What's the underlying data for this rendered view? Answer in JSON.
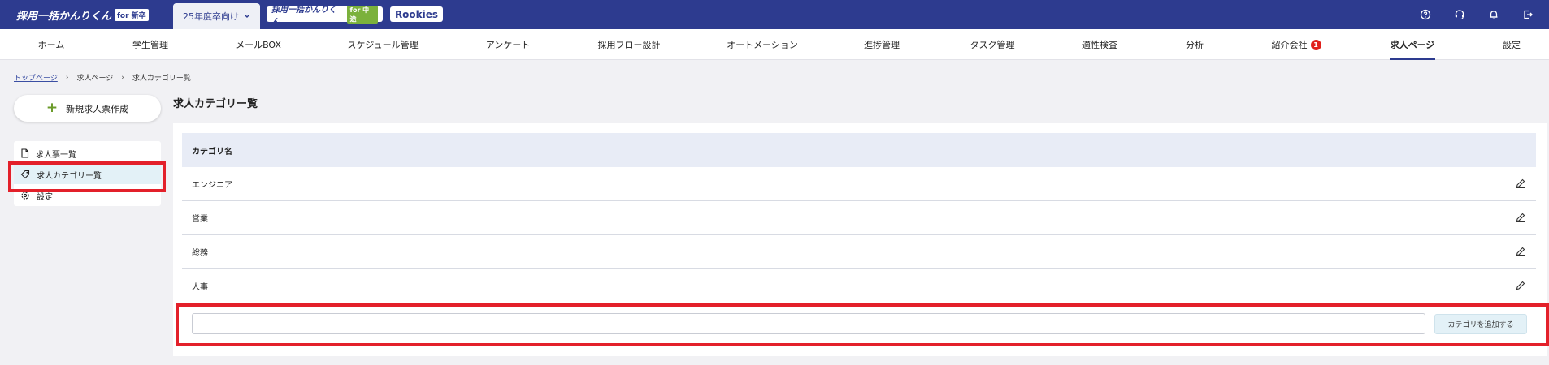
{
  "header": {
    "logo_main": "採用一括かんりくん",
    "logo_main_tag": "for 新卒",
    "year_select": "25年度卒向け",
    "logo_chuto": "採用一括かんりくん",
    "logo_chuto_tag": "for 中途",
    "logo_rookies": "Rookies",
    "icons": [
      "help-icon",
      "support-icon",
      "bell-icon",
      "logout-icon"
    ]
  },
  "nav": {
    "items": [
      {
        "label": "ホーム"
      },
      {
        "label": "学生管理"
      },
      {
        "label": "メールBOX"
      },
      {
        "label": "スケジュール管理"
      },
      {
        "label": "アンケート"
      },
      {
        "label": "採用フロー設計"
      },
      {
        "label": "オートメーション"
      },
      {
        "label": "進捗管理"
      },
      {
        "label": "タスク管理"
      },
      {
        "label": "適性検査"
      },
      {
        "label": "分析"
      },
      {
        "label": "紹介会社",
        "badge": "1"
      },
      {
        "label": "求人ページ"
      },
      {
        "label": "設定"
      }
    ],
    "active": "求人ページ"
  },
  "breadcrumb": {
    "top": "トップページ",
    "mid": "求人ページ",
    "current": "求人カテゴリー覧"
  },
  "sidebar": {
    "new_button": "新規求人票作成",
    "items": [
      {
        "label": "求人票一覧"
      },
      {
        "label": "求人カテゴリー覧"
      },
      {
        "label": "設定"
      }
    ]
  },
  "main": {
    "title": "求人カテゴリー覧",
    "table_header": "カテゴリ名",
    "rows": [
      "エンジニア",
      "営業",
      "総務",
      "人事"
    ],
    "input_value": "",
    "input_placeholder": "",
    "add_button": "カテゴリを追加する"
  },
  "colors": {
    "brand": "#2d3b8f",
    "accent_green": "#6b9b2a",
    "highlight_red": "#e3202a",
    "badge_red": "#e0201b"
  }
}
